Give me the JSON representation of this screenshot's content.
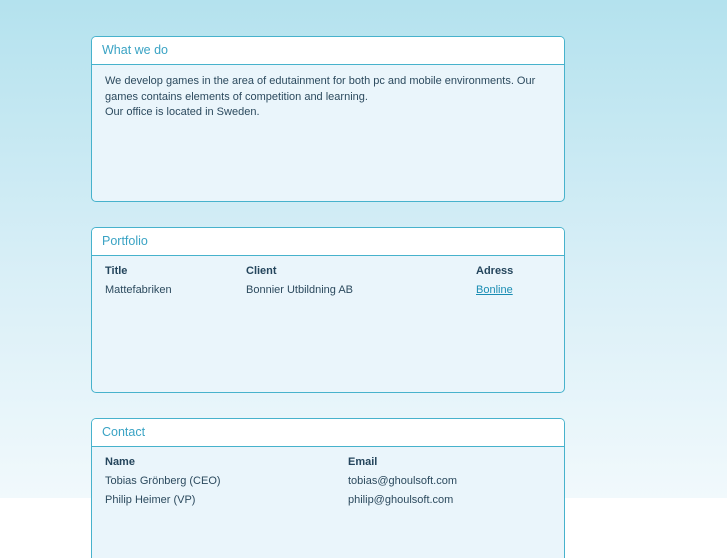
{
  "about": {
    "title": "What we do",
    "lines": [
      "We develop games in the area of edutainment for both pc and mobile environments. Our",
      "games contains elements of competition and learning.",
      "Our office is located in Sweden."
    ]
  },
  "portfolio": {
    "title": "Portfolio",
    "headers": {
      "title": "Title",
      "client": "Client",
      "adress": "Adress"
    },
    "rows": [
      {
        "title": "Mattefabriken",
        "client": "Bonnier Utbildning AB",
        "adress": "Bonline"
      }
    ]
  },
  "contact": {
    "title": "Contact",
    "headers": {
      "name": "Name",
      "email": "Email"
    },
    "rows": [
      {
        "name": "Tobias Grönberg (CEO)",
        "email": "tobias@ghoulsoft.com"
      },
      {
        "name": "Philip Heimer (VP)",
        "email": "philip@ghoulsoft.com"
      }
    ]
  }
}
